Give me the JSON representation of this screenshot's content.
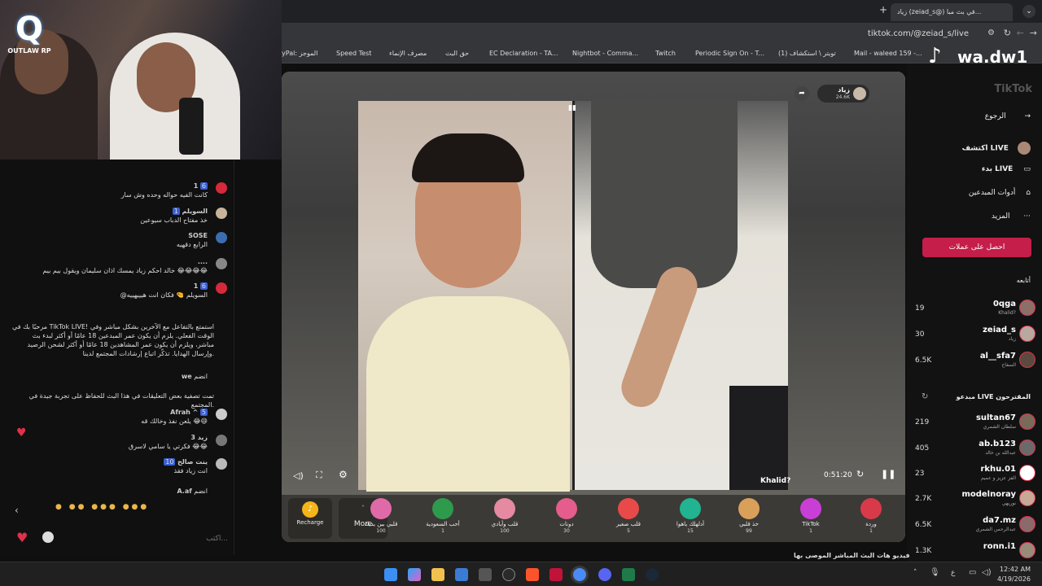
{
  "webcam": {
    "logo_text": "OUTLAW RP"
  },
  "chat": {
    "messages": [
      {
        "name": "1",
        "badge": "6",
        "text": "كانت الفيه حواله وحده وش سار"
      },
      {
        "name": "السويلم",
        "badge": "1",
        "text": "خذ مفتاح الدباب سيوعين"
      },
      {
        "name": "SOSE",
        "badge": "",
        "text": "الرابع دقهيه"
      },
      {
        "name": "....",
        "badge": "",
        "text": "خالد احكم زياد يمسك اذان سليمان ويقول بيم بيم 😂😂😂😂"
      },
      {
        "name": "1",
        "badge": "6",
        "text": "@السويلم 🤏 فكان انت هيييهييه"
      },
      {
        "name": "",
        "badge": "",
        "text": "مرحبًا بك في TikTok LIVE! استمتع بالتفاعل مع الآخرين بشكل مباشر وفي الوقت الفعلي. يلزم أن يكون عمر المبدعين 18 عامًا أو أكثر لبدء بث مباشر، ويلزم أن يكون عمر المشاهدين 18 عامًا أو أكثر لشحن الرصيد وإرسال الهدايا. تذكّر اتباع إرشادات المجتمع لدينا."
      },
      {
        "name": "we",
        "badge": "",
        "text": "انضم"
      },
      {
        "name": "",
        "badge": "",
        "text": "تمت تصفية بعض التعليقات في هذا البث للحفاظ على تجربة جيدة في المجتمع."
      },
      {
        "name": "Afrah ^",
        "badge": "5",
        "text": "يلعن نفذ وخالك قه 😂😄"
      },
      {
        "name": "3 زيد",
        "badge": "",
        "text": "فكرتي يا سامي لاسرق 😂😂"
      },
      {
        "name": "ينت صالح",
        "badge": "10",
        "text": "انت زياد فقذ"
      },
      {
        "name": "A.af",
        "badge": "",
        "text": "انضم"
      }
    ],
    "input_placeholder": "اكتب..."
  },
  "browser": {
    "tab_title": "زياد (zeiad_s@) في بث مبا...",
    "url": "tiktok.com/@zeiad_s/live",
    "bookmarks": [
      "yPal: الموجز",
      "Speed Test",
      "مصرف الإنماء",
      "حق البث",
      "EC Declaration - TA...",
      "Nightbot - Comma...",
      "Twitch",
      "Periodic Sign On - T...",
      "(1) تويتر \\ استكشاف",
      "Mail - waleed 159 -..."
    ]
  },
  "live": {
    "host_name": "زياد",
    "host_likes": "24.6K",
    "timer": "0:51:20",
    "guest_label": "Khalid?",
    "recharge": "Recharge",
    "more": "More",
    "gifts": [
      {
        "name": "قلبي بين يديك",
        "price": "100",
        "color": "#e06aa8"
      },
      {
        "name": "أحب السعودية",
        "price": "1",
        "color": "#2e9a4c"
      },
      {
        "name": "قلب وأيادي",
        "price": "100",
        "color": "#e58aa0"
      },
      {
        "name": "دونات",
        "price": "30",
        "color": "#e45d8c"
      },
      {
        "name": "قلب صغير",
        "price": "5",
        "color": "#e84a4a"
      },
      {
        "name": "أدلهلك ياهوا",
        "price": "15",
        "color": "#22b391"
      },
      {
        "name": "خذ قلبي",
        "price": "99",
        "color": "#d9a05a"
      },
      {
        "name": "TikTok",
        "price": "1",
        "color": "#c93fd6"
      },
      {
        "name": "وردة",
        "price": "1",
        "color": "#d83a4a"
      }
    ]
  },
  "sidebar": {
    "brand": "TikTok",
    "nav": [
      "الرجوع",
      "اكتشف LIVE",
      "بدء LIVE",
      "أدوات المبدعين",
      "المزيد"
    ],
    "coins_button": "احصل على عملات",
    "following_label": "أتابعه",
    "following": [
      {
        "name": "0qga",
        "sub": "Khalid?",
        "count": "19"
      },
      {
        "name": "zeiad_s",
        "sub": "زياد",
        "count": "30"
      },
      {
        "name": "al__sfa7",
        "sub": "السفاح",
        "count": "6.5K"
      }
    ],
    "suggested_label": "مبدعو LIVE المقترحون",
    "suggested": [
      {
        "name": "sultan67",
        "sub": "سلطان الشمري",
        "count": "219"
      },
      {
        "name": "ab.b123",
        "sub": "عبدالله بن خالد",
        "count": "405"
      },
      {
        "name": "rkhu.01",
        "sub": "الفز عزيز و عميم",
        "count": "23"
      },
      {
        "name": "modelnoray",
        "sub": "نوريهي",
        "count": "2.7K"
      },
      {
        "name": "da7.mz",
        "sub": "عبدالرحمن الشمري",
        "count": "6.5K"
      },
      {
        "name": "ronn.i1",
        "sub": "",
        "count": "1.3K"
      }
    ]
  },
  "overlay": {
    "wa_text": "wa.dw1",
    "ticker": "فيديو هات البث المباشر   الموصى بها"
  },
  "taskbar": {
    "time": "12:42 AM",
    "date": "4/19/2026"
  }
}
